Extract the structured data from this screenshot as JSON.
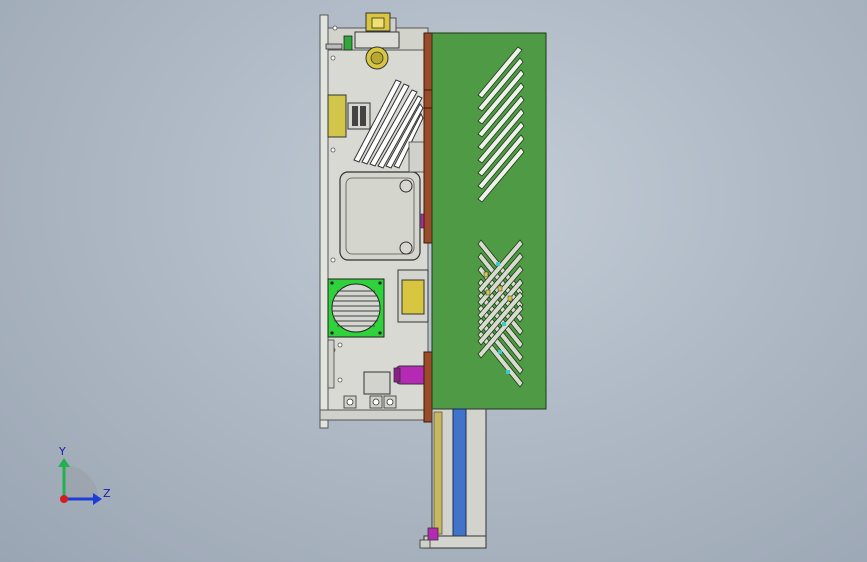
{
  "viewport": {
    "background_top": "#c3ccd6",
    "background_bottom": "#9aa5b3"
  },
  "triad": {
    "y_label": "Y",
    "z_label": "Z",
    "y_color": "#22b14c",
    "z_color": "#1e3cd6",
    "x_color": "#d21e1e"
  },
  "model": {
    "frame_color": "#d6d8d2",
    "cover_color": "#4f9a44",
    "rail_color": "#9b4a2a",
    "fan_color": "#2fd23a",
    "terminal_color": "#d2c64a",
    "cylinder_color": "#b42ab4",
    "rod_color": "#3f74c9"
  }
}
